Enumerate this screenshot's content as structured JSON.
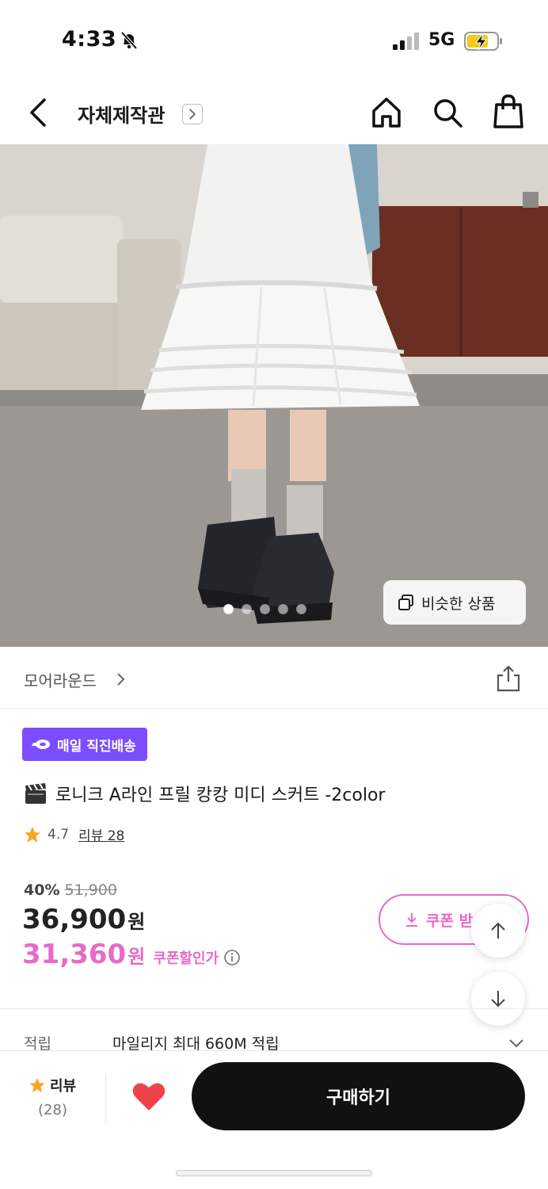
{
  "status_bar": {
    "time": "4:33",
    "network": "5G"
  },
  "nav": {
    "title": "자체제작관"
  },
  "hero": {
    "similar_label": "비슷한 상품",
    "dot_count": 5,
    "active_dot": 0
  },
  "brand": {
    "name": "모어라운드"
  },
  "product": {
    "badge": "매일 직진배송",
    "title": "로니크 A라인 프릴 캉캉 미디 스커트 -2color",
    "rating": "4.7",
    "review_label": "리뷰 28",
    "discount_rate": "40%",
    "original_price": "51,900",
    "price": "36,900",
    "price_unit": "원",
    "coupon_price": "31,360",
    "coupon_unit": "원",
    "coupon_price_label": "쿠폰할인가",
    "coupon_button": "쿠폰 받"
  },
  "points": {
    "label": "적립",
    "value": "마일리지 최대 660M 적립"
  },
  "bottom": {
    "review_label": "리뷰",
    "review_count": "(28)",
    "buy_label": "구매하기"
  },
  "colors": {
    "accent_pink": "#e86ac8",
    "badge_purple": "#7c4dff",
    "heart_red": "#f0424b"
  }
}
